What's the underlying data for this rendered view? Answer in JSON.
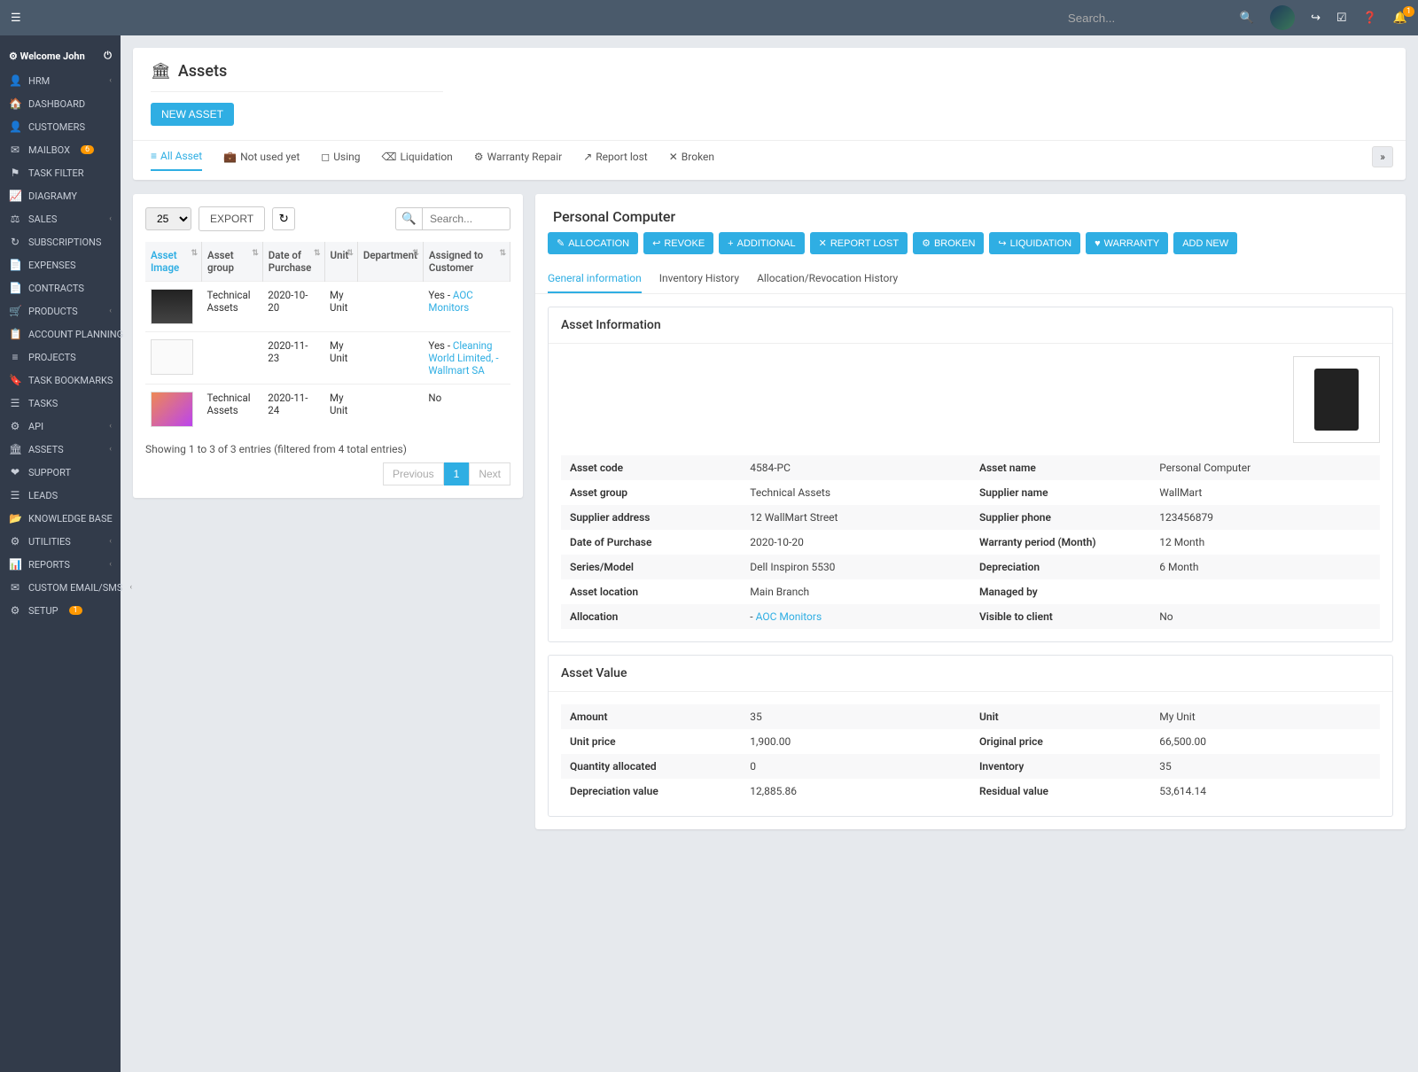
{
  "topbar": {
    "search_placeholder": "Search...",
    "bell_badge": "1"
  },
  "sidebar": {
    "welcome": "Welcome John",
    "items": [
      {
        "icon": "👤",
        "label": "HRM",
        "chev": true
      },
      {
        "icon": "🏠",
        "label": "DASHBOARD"
      },
      {
        "icon": "👤",
        "label": "CUSTOMERS"
      },
      {
        "icon": "✉",
        "label": "MAILBOX",
        "badge": "6"
      },
      {
        "icon": "⚑",
        "label": "TASK FILTER"
      },
      {
        "icon": "📈",
        "label": "DIAGRAMY"
      },
      {
        "icon": "⚖",
        "label": "SALES",
        "chev": true
      },
      {
        "icon": "↻",
        "label": "SUBSCRIPTIONS"
      },
      {
        "icon": "📄",
        "label": "EXPENSES"
      },
      {
        "icon": "📄",
        "label": "CONTRACTS"
      },
      {
        "icon": "🛒",
        "label": "PRODUCTS",
        "chev": true
      },
      {
        "icon": "📋",
        "label": "ACCOUNT PLANNING"
      },
      {
        "icon": "≡",
        "label": "PROJECTS"
      },
      {
        "icon": "🔖",
        "label": "TASK BOOKMARKS"
      },
      {
        "icon": "☰",
        "label": "TASKS"
      },
      {
        "icon": "⚙",
        "label": "API",
        "chev": true
      },
      {
        "icon": "🏛",
        "label": "ASSETS",
        "chev": true
      },
      {
        "icon": "❤",
        "label": "SUPPORT"
      },
      {
        "icon": "☰",
        "label": "LEADS"
      },
      {
        "icon": "📂",
        "label": "KNOWLEDGE BASE"
      },
      {
        "icon": "⚙",
        "label": "UTILITIES",
        "chev": true
      },
      {
        "icon": "📊",
        "label": "REPORTS",
        "chev": true
      },
      {
        "icon": "✉",
        "label": "CUSTOM EMAIL/SMS",
        "chev": true
      },
      {
        "icon": "⚙",
        "label": "SETUP",
        "badge": "1"
      }
    ]
  },
  "page": {
    "title": "Assets",
    "new_asset": "NEW ASSET",
    "tabs": [
      "All Asset",
      "Not used yet",
      "Using",
      "Liquidation",
      "Warranty Repair",
      "Report lost",
      "Broken"
    ]
  },
  "list": {
    "page_size": "25",
    "export": "EXPORT",
    "search_placeholder": "Search...",
    "cols": [
      "Asset Image",
      "Asset group",
      "Date of Purchase",
      "Unit",
      "Department",
      "Assigned to Customer"
    ],
    "rows": [
      {
        "thumb": "pc",
        "group": "Technical Assets",
        "date": "2020-10-20",
        "unit": "My Unit",
        "dept": "",
        "assigned_pre": "Yes - ",
        "assigned_link": "AOC Monitors"
      },
      {
        "thumb": "laptop",
        "group": "",
        "date": "2020-11-23",
        "unit": "My Unit",
        "dept": "",
        "assigned_pre": "Yes - ",
        "assigned_link": "Cleaning World Limited, - Wallmart SA"
      },
      {
        "thumb": "tablet",
        "group": "Technical Assets",
        "date": "2020-11-24",
        "unit": "My Unit",
        "dept": "",
        "assigned_pre": "No",
        "assigned_link": ""
      }
    ],
    "footer_info": "Showing 1 to 3 of 3 entries (filtered from 4 total entries)",
    "prev": "Previous",
    "next": "Next",
    "page": "1"
  },
  "detail": {
    "title": "Personal Computer",
    "actions": [
      "ALLOCATION",
      "REVOKE",
      "ADDITIONAL",
      "REPORT LOST",
      "BROKEN",
      "LIQUIDATION",
      "WARRANTY",
      "ADD NEW"
    ],
    "tabs": [
      "General information",
      "Inventory History",
      "Allocation/Revocation History"
    ],
    "info_header": "Asset Information",
    "info": [
      {
        "l1": "Asset code",
        "v1": "4584-PC",
        "l2": "Asset name",
        "v2": "Personal Computer"
      },
      {
        "l1": "Asset group",
        "v1": "Technical Assets",
        "l2": "Supplier name",
        "v2": "WallMart"
      },
      {
        "l1": "Supplier address",
        "v1": "12 WallMart Street",
        "l2": "Supplier phone",
        "v2": "123456879"
      },
      {
        "l1": "Date of Purchase",
        "v1": "2020-10-20",
        "l2": "Warranty period (Month)",
        "v2": "12 Month"
      },
      {
        "l1": "Series/Model",
        "v1": "Dell Inspiron 5530",
        "l2": "Depreciation",
        "v2": "6 Month"
      },
      {
        "l1": "Asset location",
        "v1": "Main Branch",
        "l2": "Managed by",
        "v2": ""
      },
      {
        "l1": "Allocation",
        "v1_pre": "- ",
        "v1_link": "AOC Monitors",
        "l2": "Visible to client",
        "v2": "No"
      }
    ],
    "value_header": "Asset Value",
    "value": [
      {
        "l1": "Amount",
        "v1": "35",
        "l2": "Unit",
        "v2": "My Unit"
      },
      {
        "l1": "Unit price",
        "v1": "1,900.00",
        "l2": "Original price",
        "v2": "66,500.00"
      },
      {
        "l1": "Quantity allocated",
        "v1": "0",
        "l2": "Inventory",
        "v2": "35"
      },
      {
        "l1": "Depreciation value",
        "v1": "12,885.86",
        "l2": "Residual value",
        "v2": "53,614.14"
      }
    ]
  }
}
